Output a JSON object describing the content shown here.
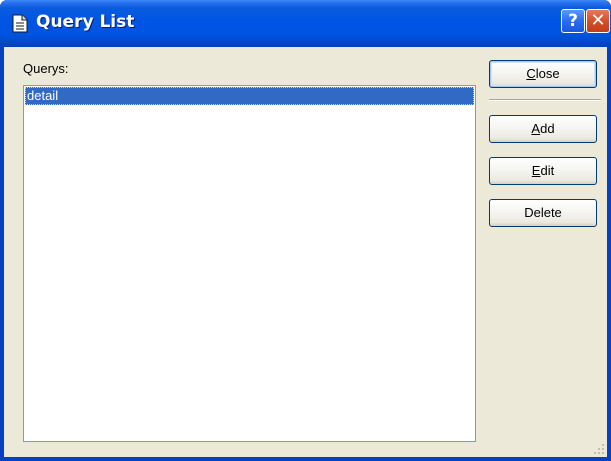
{
  "window": {
    "title": "Query List",
    "icons": {
      "app": "document-icon",
      "help": "help-icon",
      "close": "close-icon"
    },
    "help_glyph": "?",
    "close_glyph": "✕"
  },
  "main": {
    "list_label": "Querys:",
    "queries": [
      {
        "label": "detail",
        "selected": true
      }
    ]
  },
  "buttons": {
    "close": {
      "mnemonic": "C",
      "rest": "lose"
    },
    "add": {
      "mnemonic": "A",
      "rest": "dd"
    },
    "edit": {
      "mnemonic": "E",
      "rest": "dit"
    },
    "delete": {
      "label": "Delete"
    }
  },
  "colors": {
    "titlebar": "#0054e3",
    "selection": "#316ac5",
    "dialog_bg": "#ece9d8"
  }
}
